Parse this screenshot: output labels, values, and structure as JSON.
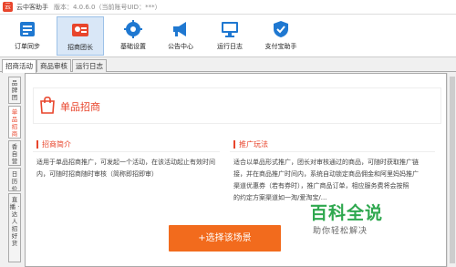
{
  "window": {
    "title": "云中客助手",
    "version": "版本：4.0.6.0（当前账号UID：***）"
  },
  "toolbar": {
    "items": [
      {
        "label": "订单同步",
        "icon": "order-sync-icon"
      },
      {
        "label": "招商团长",
        "icon": "recruit-leader-icon"
      },
      {
        "label": "基础设置",
        "icon": "gear-icon"
      },
      {
        "label": "公告中心",
        "icon": "megaphone-icon"
      },
      {
        "label": "运行日志",
        "icon": "monitor-icon"
      },
      {
        "label": "支付宝助手",
        "icon": "shield-icon"
      }
    ],
    "active_index": 1
  },
  "tabs": [
    "招商活动",
    "商品审核",
    "运行日志"
  ],
  "active_tab": 0,
  "side_tabs": [
    "品牌团",
    "单品招商",
    "香自营",
    "日历价",
    "直播 · 达人招好货"
  ],
  "active_side_tab": 1,
  "hero": {
    "title": "单品招商"
  },
  "sections": {
    "intro": {
      "title": "招商简介",
      "lines": [
        "适用于单品招商推广，可发起一个活动，在该活动起止有效时间",
        "内，可随时招商随时审核（简称即招即审）"
      ]
    },
    "promo": {
      "title": "推广玩法",
      "lines": [
        "适合以单品形式推广，团长对审核通过的商品，可随时获取推广链",
        "接，并在商品推广时间内，系统自动锁定商品佣金和阿里妈妈推广",
        "渠道优惠券（若有券时），推广商品订单，相应服务费将会按照",
        "的约定方案渠道如一淘/爱淘宝/..."
      ]
    }
  },
  "cta": {
    "label": "+选择该场景"
  },
  "watermark": {
    "main": "百科全说",
    "sub": "助你轻松解决"
  },
  "colors": {
    "accent": "#e8452c",
    "cta": "#f26b1d",
    "watermark": "#2fa84f"
  }
}
